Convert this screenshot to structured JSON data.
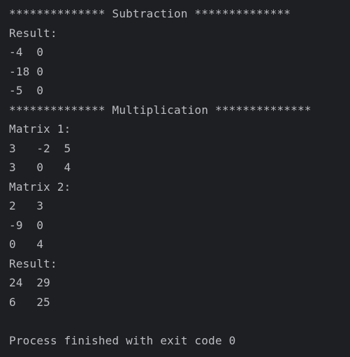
{
  "console": {
    "lines": [
      "************** Subtraction **************",
      "Result:",
      "-4  0",
      "-18 0",
      "-5  0",
      "************** Multiplication **************",
      "Matrix 1:",
      "3   -2  5",
      "3   0   4",
      "Matrix 2:",
      "2   3",
      "-9  0",
      "0   4",
      "Result:",
      "24  29",
      "6   25",
      "",
      "Process finished with exit code 0"
    ]
  },
  "colors": {
    "background": "#1e1f22",
    "text": "#bcbec4"
  }
}
